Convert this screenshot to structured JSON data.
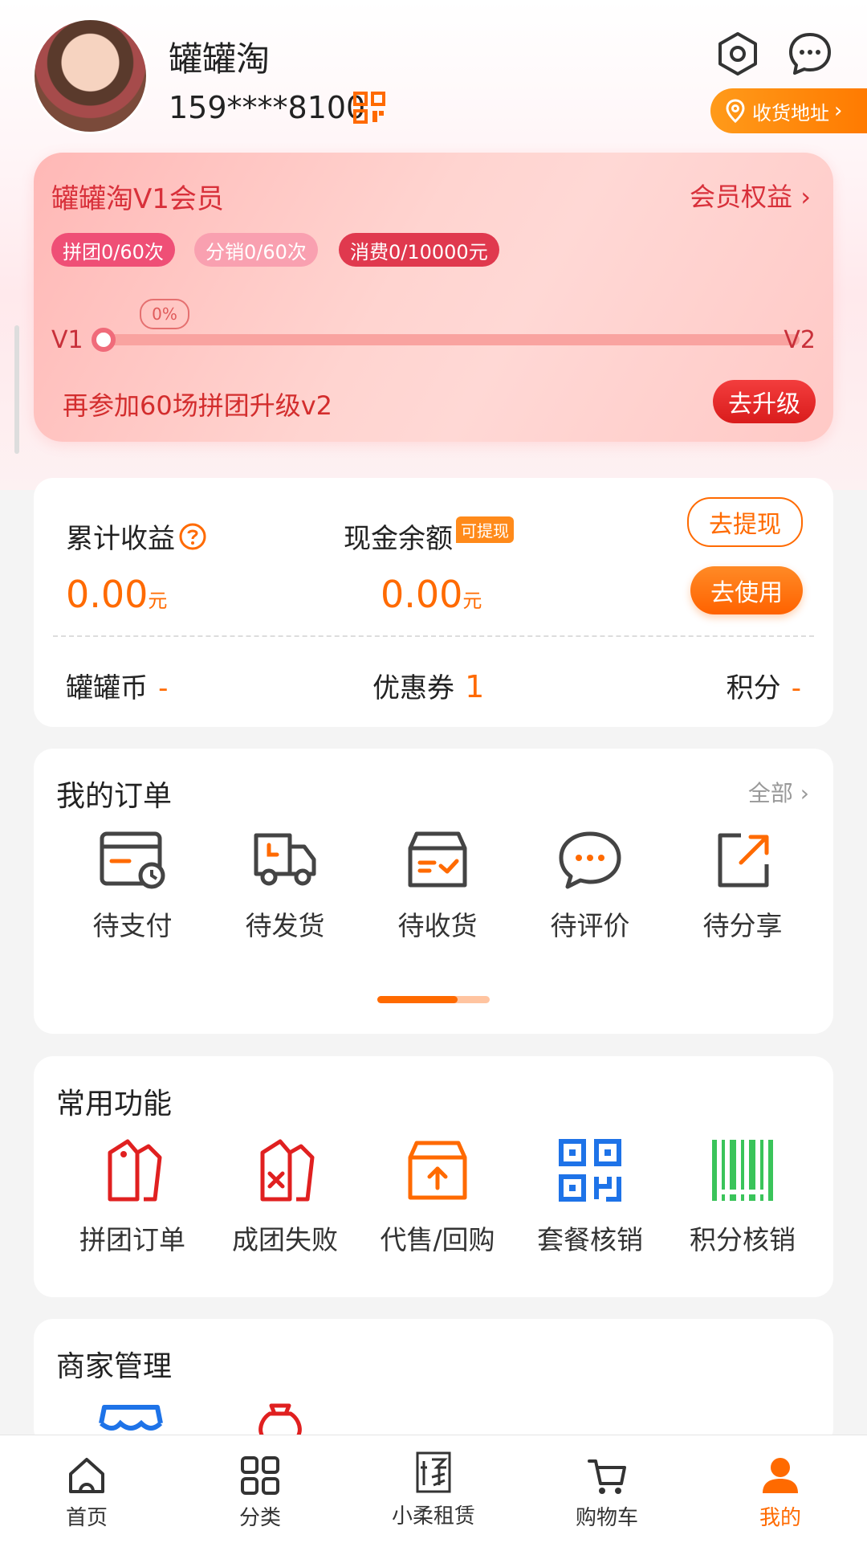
{
  "user": {
    "name": "罐罐淘",
    "phone": "159****8100"
  },
  "header": {
    "address_label": "收货地址"
  },
  "member": {
    "title": "罐罐淘V1会员",
    "rights": "会员权益",
    "badges": [
      "拼团0/60次",
      "分销0/60次",
      "消费0/10000元"
    ],
    "progress_text": "0%",
    "progress_value": 0,
    "level_from": "V1",
    "level_to": "V2",
    "tip": "再参加60场拼团升级v2",
    "upgrade": "去升级"
  },
  "earnings": {
    "total_label": "累计收益",
    "total_value": "0.00",
    "cash_label": "现金余额",
    "cash_tag": "可提现",
    "cash_value": "0.00",
    "unit": "元",
    "withdraw": "去提现",
    "use": "去使用",
    "coins_label": "罐罐币",
    "coins_value": "-",
    "coupon_label": "优惠券",
    "coupon_value": "1",
    "points_label": "积分",
    "points_value": "-"
  },
  "orders": {
    "title": "我的订单",
    "all": "全部",
    "items": [
      {
        "label": "待支付",
        "icon": "wallet-clock-icon"
      },
      {
        "label": "待发货",
        "icon": "truck-icon"
      },
      {
        "label": "待收货",
        "icon": "box-check-icon"
      },
      {
        "label": "待评价",
        "icon": "chat-bubble-icon"
      },
      {
        "label": "待分享",
        "icon": "share-icon"
      }
    ]
  },
  "functions": {
    "title": "常用功能",
    "items": [
      {
        "label": "拼团订单",
        "icon": "tag-icon"
      },
      {
        "label": "成团失败",
        "icon": "tag-fail-icon"
      },
      {
        "label": "代售/回购",
        "icon": "box-upload-icon"
      },
      {
        "label": "套餐核销",
        "icon": "qrcode-icon"
      },
      {
        "label": "积分核销",
        "icon": "barcode-icon"
      }
    ]
  },
  "merchant": {
    "title": "商家管理"
  },
  "tabs": [
    {
      "label": "首页",
      "icon": "home-icon"
    },
    {
      "label": "分类",
      "icon": "grid-icon"
    },
    {
      "label": "小柔租赁",
      "icon": "rent-icon"
    },
    {
      "label": "购物车",
      "icon": "cart-icon"
    },
    {
      "label": "我的",
      "icon": "user-icon",
      "active": true
    }
  ],
  "colors": {
    "accent": "#ff6a00",
    "member_red": "#d8303a",
    "badge_pink": "#ef4f76",
    "qr_blue": "#1e73e8",
    "barcode_green": "#3ac45a"
  }
}
